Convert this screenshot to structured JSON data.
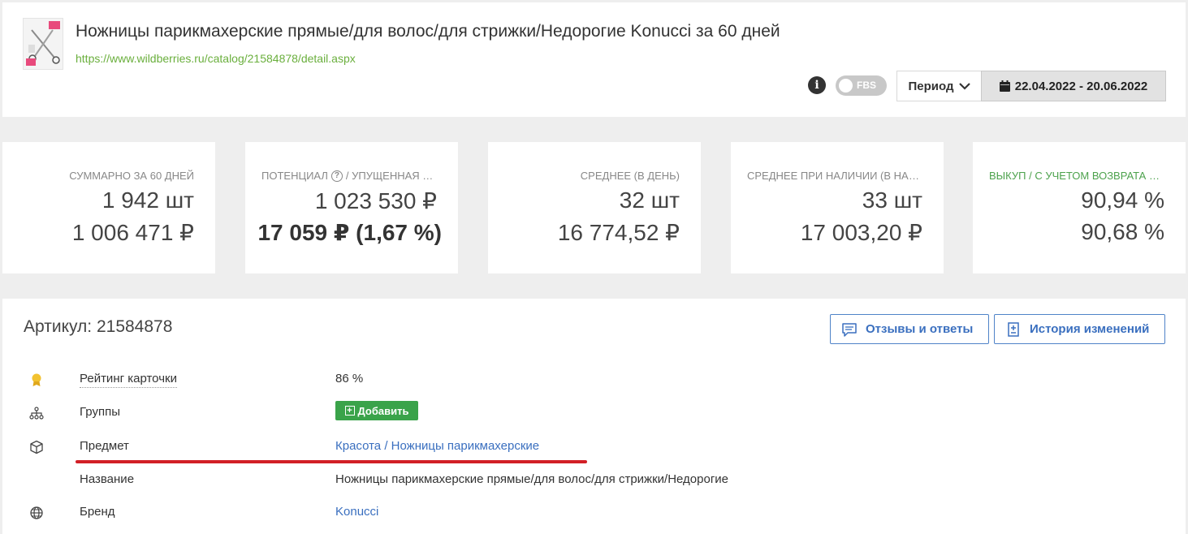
{
  "header": {
    "title": "Ножницы парикмахерские прямые/для волос/для стрижки/Недорогие Konucci за 60 дней",
    "url": "https://www.wildberries.ru/catalog/21584878/detail.aspx",
    "toggle_label": "FBS",
    "period_label": "Период",
    "date_range": "22.04.2022 - 20.06.2022",
    "icons": {
      "info": "info-icon",
      "toggle": "toggle-switch",
      "period": "chevron-down-icon",
      "date": "calendar-icon"
    }
  },
  "stats": [
    {
      "caption": "СУММАРНО ЗА 60 ДНЕЙ",
      "value1": "1 942 шт",
      "value2": "1 006 471 ₽"
    },
    {
      "caption": "ПОТЕНЦИАЛ",
      "caption_suffix": "/ УПУЩЕННАЯ ВЫРУЧКА",
      "value1": "1 023 530 ₽",
      "value2": "17 059 ₽ (1,67 %)"
    },
    {
      "caption": "СРЕДНЕЕ (В ДЕНЬ)",
      "value1": "32 шт",
      "value2": "16 774,52 ₽"
    },
    {
      "caption": "СРЕДНЕЕ ПРИ НАЛИЧИИ (В НАЛИЧИИ ДНЕЙ)",
      "value1": "33 шт",
      "value2": "17 003,20 ₽"
    },
    {
      "caption": "ВЫКУП / С УЧЕТОМ ВОЗВРАТА ТОВАРОВ",
      "value1": "90,94 %",
      "value2": "90,68 %"
    }
  ],
  "colors": {
    "url": "#6aaf3d",
    "accent_blue": "#3a6fbf",
    "green_button": "#3aa34a",
    "highlight_red": "#d21f26",
    "buyout_caption": "#4da24d"
  },
  "details": {
    "title": "Артикул: 21584878",
    "reviews_button": "Отзывы и ответы",
    "history_button": "История изменений",
    "rows": [
      {
        "icon": "award-icon",
        "label": "Рейтинг карточки",
        "value": "86 %"
      },
      {
        "icon": "hierarchy-icon",
        "label": "Группы",
        "add_label": "Добавить"
      },
      {
        "icon": "box-icon",
        "label": "Предмет",
        "value": "Красота / Ножницы парикмахерские"
      },
      {
        "icon": "",
        "label": "Название",
        "value": "Ножницы парикмахерские прямые/для волос/для стрижки/Недорогие"
      },
      {
        "icon": "globe-icon",
        "label": "Бренд",
        "value": "Konucci"
      }
    ]
  }
}
